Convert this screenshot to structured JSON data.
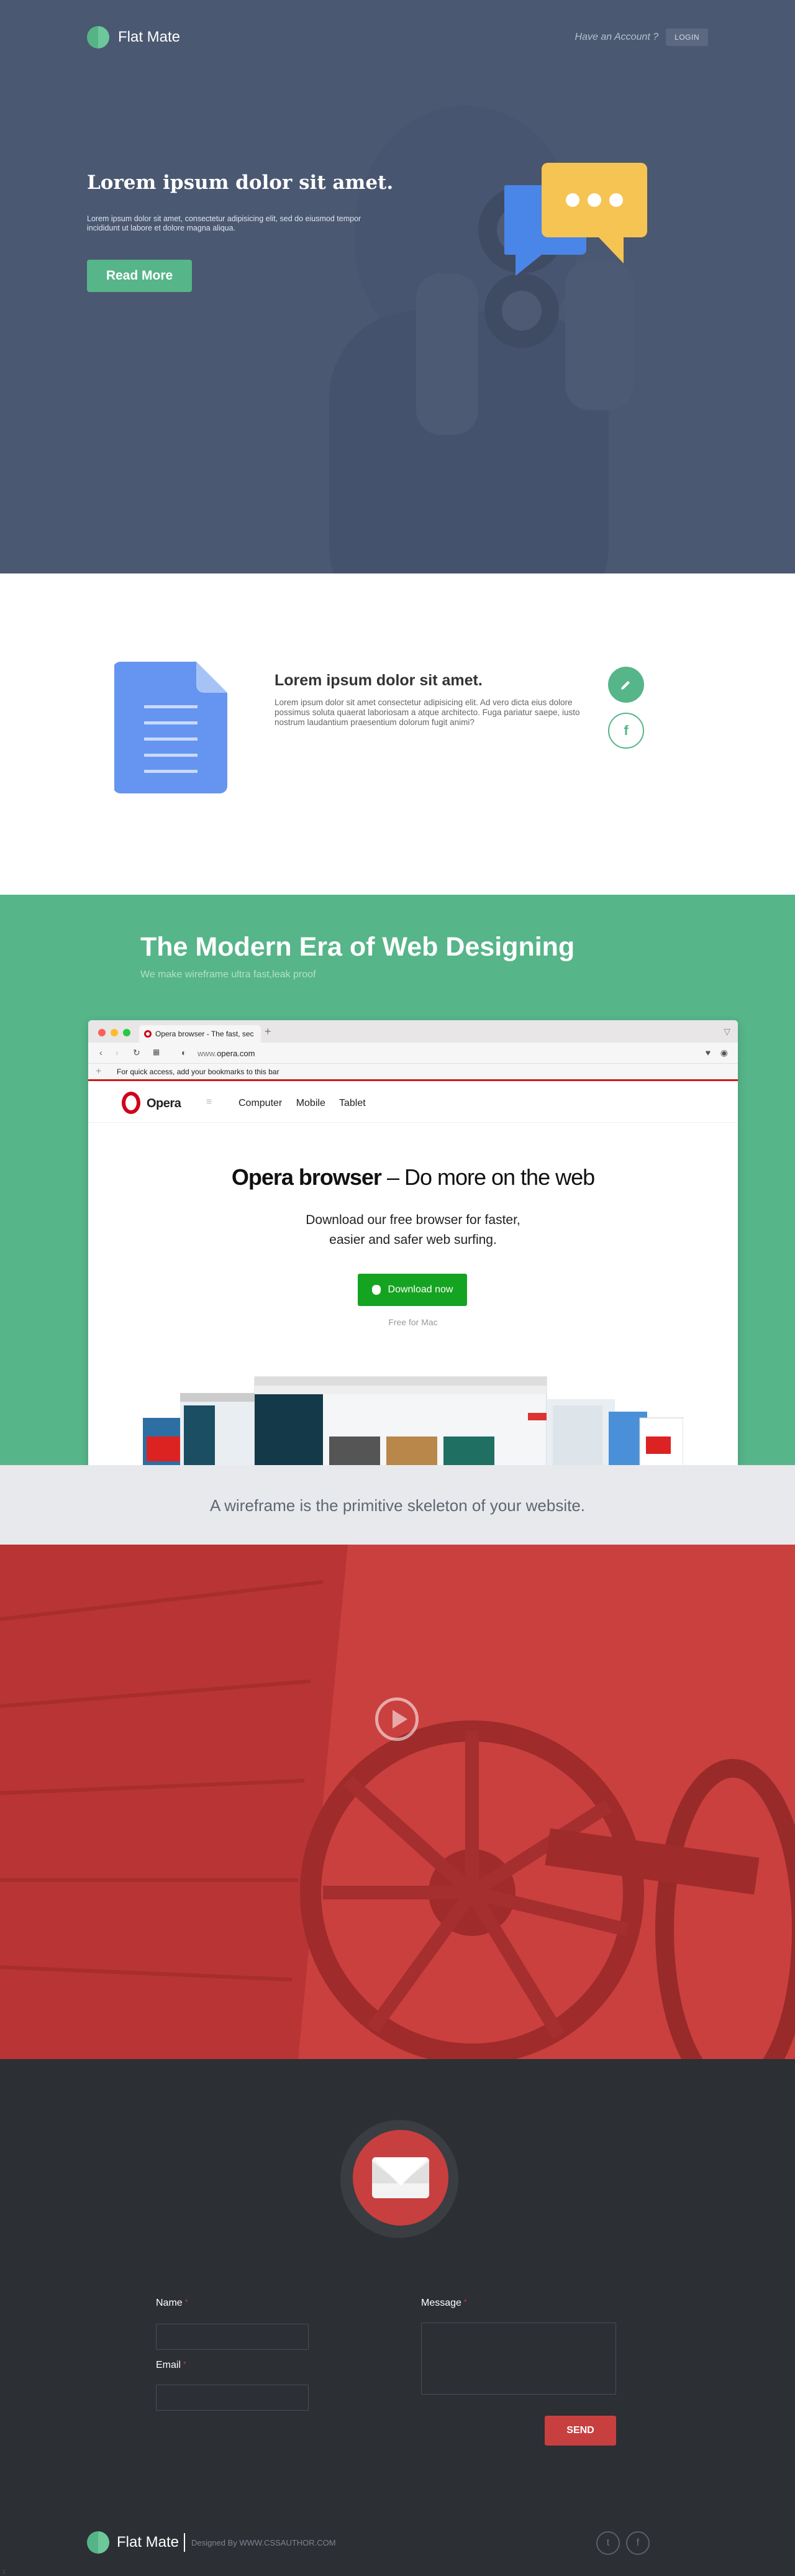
{
  "nav": {
    "brand": "Flat Mate",
    "account_text": "Have an Account ?",
    "login_label": "LOGIN"
  },
  "hero": {
    "title": "Lorem ipsum dolor sit amet.",
    "text": "Lorem ipsum dolor sit amet, consectetur adipisicing elit, sed do eiusmod tempor incididunt ut labore et dolore magna aliqua.",
    "button_label": "Read More"
  },
  "feature": {
    "title": "Lorem ipsum dolor sit amet.",
    "text": "Lorem ipsum dolor sit amet consectetur adipisicing elit. Ad vero dicta eius dolore possimus soluta quaerat laboriosam a atque architecto. Fuga pariatur saepe, iusto nostrum laudantium praesentium dolorum fugit animi?",
    "fb_glyph": "f"
  },
  "green": {
    "title": "The Modern Era of Web Designing",
    "subtitle": "We make wireframe ultra fast,leak proof"
  },
  "browser": {
    "tab_title": "Opera browser - The fast, sec",
    "url_domain": "www.",
    "url_host": "opera.com",
    "bookmarks_hint": "For quick access, add your bookmarks to this bar",
    "brand": "Opera",
    "menu_glyph": "≡",
    "links": [
      "Computer",
      "Mobile",
      "Tablet"
    ],
    "headline_bold": "Opera browser",
    "headline_rest": " – Do more on the web",
    "desc_line1": "Download our free browser for faster,",
    "desc_line2": "easier and safer web surfing.",
    "download_label": "Download now",
    "free_label": "Free for Mac"
  },
  "band": {
    "text": "A wireframe is the primitive skeleton of your website."
  },
  "contact": {
    "name_label": "Name",
    "email_label": "Email",
    "message_label": "Message",
    "required_mark": "*",
    "send_label": "SEND"
  },
  "footer": {
    "brand": "Flat Mate",
    "credit": "Designed By WWW.CSSAUTHOR.COM",
    "twitter_glyph": "t",
    "facebook_glyph": "f",
    "bottom_mark": "1"
  },
  "colors": {
    "hero_bg": "#4b5871",
    "accent_green": "#56b589",
    "accent_red": "#c83f3f",
    "footer_bg": "#2c2f34",
    "band_bg": "#e8e9ec"
  }
}
